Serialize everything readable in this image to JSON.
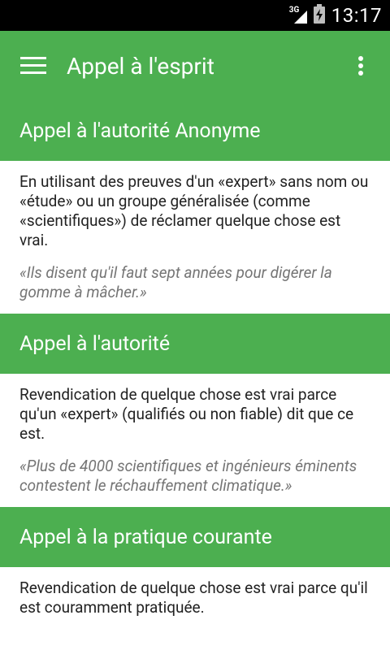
{
  "status_bar": {
    "network": "3G",
    "time": "13:17",
    "icons": [
      "signal-icon",
      "battery-charging-icon"
    ]
  },
  "app_bar": {
    "title": "Appel à l'esprit",
    "menu_icon": "hamburger-menu-icon",
    "overflow_icon": "more-vertical-icon"
  },
  "colors": {
    "primary": "#4caf50",
    "status_bar": "#000000",
    "text": "#222222",
    "example_text": "#757575"
  },
  "items": [
    {
      "title": "Appel à l'autorité Anonyme",
      "description": "En utilisant des preuves d'un «expert» sans nom ou «étude» ou un groupe généralisée (comme «scientifiques») de réclamer quelque chose est vrai.",
      "example": "«Ils disent qu'il faut sept années pour digérer la gomme à mâcher.»"
    },
    {
      "title": "Appel à l'autorité",
      "description": "Revendication de quelque chose est vrai parce qu'un «expert» (qualifiés ou non fiable) dit que ce est.",
      "example": "«Plus de 4000 scientifiques et ingénieurs éminents contestent le réchauffement climatique.»"
    },
    {
      "title": "Appel à la pratique courante",
      "description": "Revendication de quelque chose est vrai parce qu'il est couramment pratiquée.",
      "example": ""
    }
  ]
}
